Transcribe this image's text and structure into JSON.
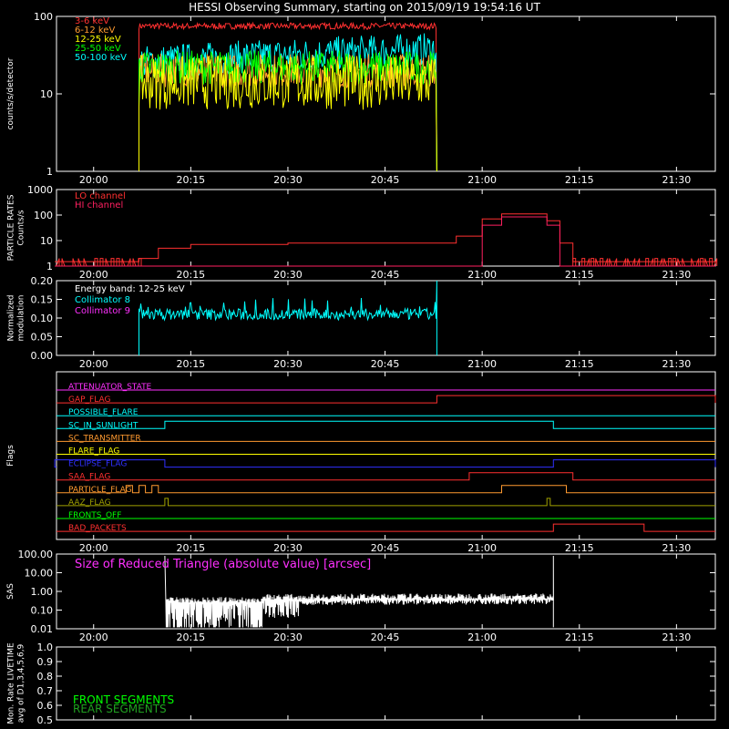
{
  "title": "HESSI Observing Summary, starting on 2015/09/19 19:54:16 UT",
  "time_ticks": [
    "20:00",
    "20:15",
    "20:30",
    "20:45",
    "21:00",
    "21:15",
    "21:30"
  ],
  "colors": {
    "red": "#ff3030",
    "orange": "#ff9a30",
    "yellow": "#ffff00",
    "green": "#00ff00",
    "cyan": "#00ffff",
    "magenta": "#ff30ff",
    "crimson": "#ff2060",
    "blue": "#3030ff",
    "olive": "#a0a000",
    "white": "#ffffff",
    "darkgreen": "#20a020"
  },
  "chart_data": [
    {
      "id": "counts",
      "type": "line",
      "ylabel": "counts/s/detector",
      "yscale": "log",
      "ylim": [
        1,
        100
      ],
      "ytick_labels": [
        "100",
        "10",
        "1"
      ],
      "time_range": [
        "19:54:16",
        "21:36"
      ],
      "data_interval": [
        "20:07",
        "20:53"
      ],
      "series": [
        {
          "name": "3-6 keV",
          "color": "#ff3030",
          "level": 75
        },
        {
          "name": "6-12 keV",
          "color": "#ff9a30",
          "level": 20
        },
        {
          "name": "12-25 keV",
          "color": "#ffff00",
          "level": 14
        },
        {
          "name": "25-50 keV",
          "color": "#00ff00",
          "level": 22
        },
        {
          "name": "50-100 keV",
          "color": "#00ffff",
          "level": 30
        }
      ]
    },
    {
      "id": "particle",
      "type": "line",
      "ylabel": "PARTICLE RATES Counts/s",
      "yscale": "log",
      "ylim": [
        1,
        1000
      ],
      "ytick_labels": [
        "1000",
        "100",
        "10",
        "1"
      ],
      "series": [
        {
          "name": "LO channel",
          "color": "#ff3030",
          "points": [
            [
              "19:54",
              1.5
            ],
            [
              "20:07",
              2
            ],
            [
              "20:10",
              5
            ],
            [
              "20:15",
              7
            ],
            [
              "20:30",
              8
            ],
            [
              "20:50",
              8
            ],
            [
              "20:53",
              8
            ],
            [
              "20:56",
              15
            ],
            [
              "21:00",
              70
            ],
            [
              "21:03",
              110
            ],
            [
              "21:07",
              110
            ],
            [
              "21:10",
              60
            ],
            [
              "21:12",
              8
            ],
            [
              "21:14",
              1.5
            ],
            [
              "21:36",
              1.5
            ]
          ]
        },
        {
          "name": "HI channel",
          "color": "#ff2060",
          "points": [
            [
              "19:54",
              1
            ],
            [
              "20:57",
              1
            ],
            [
              "21:00",
              40
            ],
            [
              "21:03",
              85
            ],
            [
              "21:07",
              85
            ],
            [
              "21:10",
              40
            ],
            [
              "21:12",
              1
            ],
            [
              "21:36",
              1
            ]
          ]
        }
      ]
    },
    {
      "id": "modulation",
      "type": "line",
      "ylabel": "Normalized modulation",
      "ylim": [
        0.0,
        0.2
      ],
      "ytick_labels": [
        "0.20",
        "0.15",
        "0.10",
        "0.05",
        "0.00"
      ],
      "annotation": "Energy band: 12-25 keV",
      "series": [
        {
          "name": "Collimator 8",
          "color": "#00ffff",
          "level": 0.11
        },
        {
          "name": "Collimator 9",
          "color": "#ff30ff"
        }
      ]
    },
    {
      "id": "flags",
      "type": "line",
      "ylabel": "Flags",
      "series": [
        {
          "name": "ATTENUATOR_STATE",
          "color": "#ff30ff",
          "on": []
        },
        {
          "name": "GAP_FLAG",
          "color": "#ff3030",
          "on": [
            [
              "20:53",
              "21:36"
            ]
          ]
        },
        {
          "name": "POSSIBLE_FLARE",
          "color": "#00ffff",
          "on": []
        },
        {
          "name": "SC_IN_SUNLIGHT",
          "color": "#00ffff",
          "on": [
            [
              "20:11",
              "21:11"
            ]
          ]
        },
        {
          "name": "SC_TRANSMITTER",
          "color": "#ff9a30",
          "on": []
        },
        {
          "name": "FLARE_FLAG",
          "color": "#ffff00",
          "on": []
        },
        {
          "name": "ECLIPSE_FLAG",
          "color": "#3030ff",
          "on": [
            [
              "19:54",
              "20:11"
            ],
            [
              "21:11",
              "21:36"
            ]
          ]
        },
        {
          "name": "SAA_FLAG",
          "color": "#ff3030",
          "on": [
            [
              "20:58",
              "21:14"
            ]
          ]
        },
        {
          "name": "PARTICLE_FLAG",
          "color": "#ff9a30",
          "on": [
            [
              "20:05",
              "20:06"
            ],
            [
              "20:07",
              "20:08"
            ],
            [
              "20:09",
              "20:10"
            ],
            [
              "21:03",
              "21:13"
            ]
          ]
        },
        {
          "name": "AAZ_FLAG",
          "color": "#a0a000",
          "on": [
            [
              "20:11",
              "20:11:30"
            ],
            [
              "21:10",
              "21:10:30"
            ]
          ]
        },
        {
          "name": "FRONTS_OFF",
          "color": "#00ff00",
          "on": []
        },
        {
          "name": "BAD_PACKETS",
          "color": "#ff3030",
          "on": [
            [
              "21:11",
              "21:25"
            ]
          ]
        }
      ]
    },
    {
      "id": "sas",
      "type": "line",
      "ylabel": "SAS",
      "yscale": "log",
      "ylim": [
        0.01,
        100
      ],
      "ytick_labels": [
        "100.00",
        "10.00",
        "1.00",
        "0.10",
        "0.01"
      ],
      "annotation": "Size of Reduced Triangle (absolute value) [arcsec]",
      "series": [
        {
          "name": "SAS triangle",
          "color": "#ffffff",
          "points": [
            [
              "20:11",
              80
            ],
            [
              "20:12",
              0.3
            ],
            [
              "20:20",
              0.2
            ],
            [
              "20:30",
              0.3
            ],
            [
              "20:40",
              0.35
            ],
            [
              "21:00",
              0.4
            ],
            [
              "21:10",
              0.4
            ],
            [
              "21:11",
              80
            ]
          ]
        }
      ]
    },
    {
      "id": "livetime",
      "type": "line",
      "ylabel": "Mon. Rate LIVETIME avg of D1,3,4,5,6,9",
      "ylim": [
        0.5,
        1.0
      ],
      "ytick_labels": [
        "1.0",
        "0.9",
        "0.8",
        "0.7",
        "0.6",
        "0.5"
      ],
      "series": [
        {
          "name": "FRONT SEGMENTS",
          "color": "#00ff00"
        },
        {
          "name": "REAR SEGMENTS",
          "color": "#20a020"
        }
      ]
    }
  ]
}
